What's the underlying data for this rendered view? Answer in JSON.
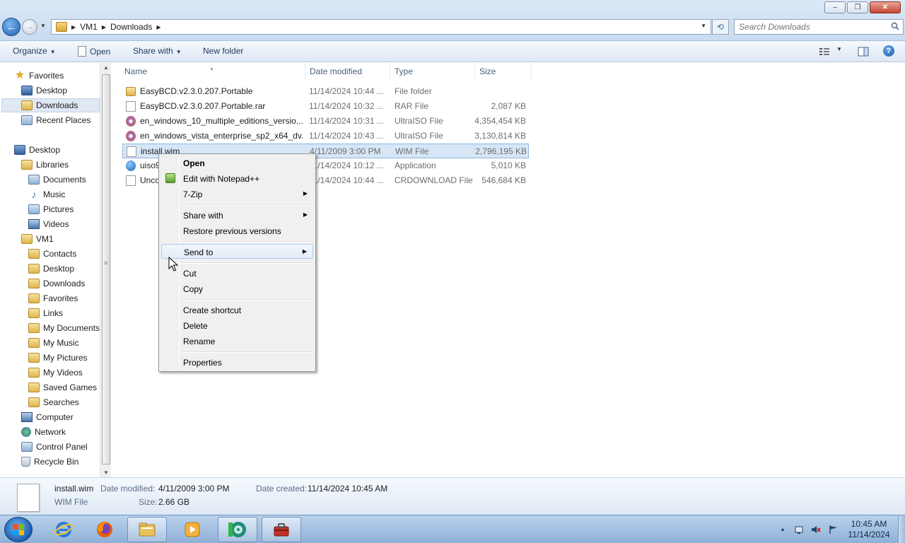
{
  "window": {
    "controls": {
      "minimize": "‒",
      "maximize": "❐",
      "close": "✕"
    }
  },
  "address": {
    "crumbs": [
      "VM1",
      "Downloads"
    ],
    "search_placeholder": "Search Downloads"
  },
  "toolbar": {
    "organize": "Organize",
    "open": "Open",
    "share_with": "Share with",
    "new_folder": "New folder",
    "help": "?"
  },
  "nav": {
    "favorites": "Favorites",
    "fav_items": [
      "Desktop",
      "Downloads",
      "Recent Places"
    ],
    "desktop": "Desktop",
    "libraries": "Libraries",
    "lib_items": [
      "Documents",
      "Music",
      "Pictures",
      "Videos"
    ],
    "vm1": "VM1",
    "vm1_items": [
      "Contacts",
      "Desktop",
      "Downloads",
      "Favorites",
      "Links",
      "My Documents",
      "My Music",
      "My Pictures",
      "My Videos",
      "Saved Games",
      "Searches"
    ],
    "computer": "Computer",
    "network": "Network",
    "control_panel": "Control Panel",
    "recycle_bin": "Recycle Bin"
  },
  "columns": {
    "name": "Name",
    "date": "Date modified",
    "type": "Type",
    "size": "Size"
  },
  "files": [
    {
      "name": "EasyBCD.v2.3.0.207.Portable",
      "date": "11/14/2024 10:44 ...",
      "type": "File folder",
      "size": "",
      "icon": "folder-icon"
    },
    {
      "name": "EasyBCD.v2.3.0.207.Portable.rar",
      "date": "11/14/2024 10:32 ...",
      "type": "RAR File",
      "size": "2,087 KB",
      "icon": "document-icon"
    },
    {
      "name": "en_windows_10_multiple_editions_versio...",
      "date": "11/14/2024 10:31 ...",
      "type": "UltraISO File",
      "size": "4,354,454 KB",
      "icon": "disc-image-icon"
    },
    {
      "name": "en_windows_vista_enterprise_sp2_x64_dv...",
      "date": "11/14/2024 10:43 ...",
      "type": "UltraISO File",
      "size": "3,130,814 KB",
      "icon": "disc-image-icon"
    },
    {
      "name": "install.wim",
      "date": "4/11/2009 3:00 PM",
      "type": "WIM File",
      "size": "2,796,195 KB",
      "icon": "document-icon"
    },
    {
      "name": "uiso9",
      "date": "11/14/2024 10:12 ...",
      "type": "Application",
      "size": "5,010 KB",
      "icon": "application-icon"
    },
    {
      "name": "Unco",
      "date": "11/14/2024 10:44 ...",
      "type": "CRDOWNLOAD File",
      "size": "546,684 KB",
      "icon": "document-icon"
    }
  ],
  "context_menu": {
    "open": "Open",
    "edit_notepad": "Edit with Notepad++",
    "seven_zip": "7-Zip",
    "share_with": "Share with",
    "restore": "Restore previous versions",
    "send_to": "Send to",
    "cut": "Cut",
    "copy": "Copy",
    "create_shortcut": "Create shortcut",
    "delete": "Delete",
    "rename": "Rename",
    "properties": "Properties"
  },
  "details": {
    "filename": "install.wim",
    "filetype": "WIM File",
    "date_modified_label": "Date modified:",
    "date_modified": "4/11/2009 3:00 PM",
    "date_created_label": "Date created:",
    "date_created": "11/14/2024 10:45 AM",
    "size_label": "Size:",
    "size": "2.66 GB"
  },
  "taskbar": {
    "time": "10:45 AM",
    "date": "11/14/2024",
    "pinned": [
      "internet-explorer-icon",
      "firefox-icon",
      "file-explorer-icon",
      "media-player-icon",
      "ultraiso-icon",
      "toolbox-icon"
    ]
  },
  "colors": {
    "selection": "#d7e6f7",
    "menu_highlight": "#e3ecf7",
    "accent": "#1f5aa8"
  }
}
